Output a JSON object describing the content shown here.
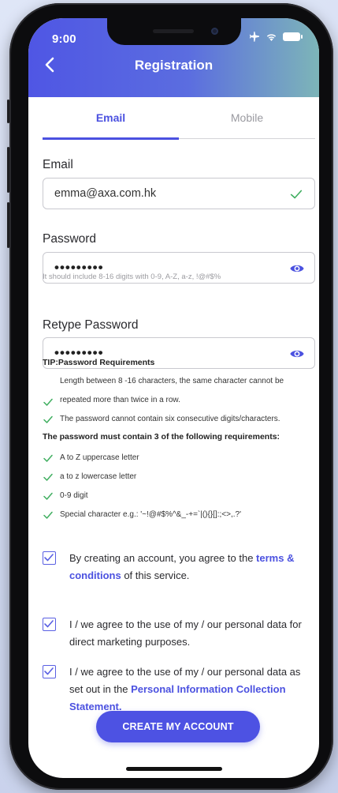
{
  "status_bar": {
    "time": "9:00"
  },
  "header": {
    "title": "Registration"
  },
  "tabs": [
    {
      "label": "Email",
      "active": true
    },
    {
      "label": "Mobile",
      "active": false
    }
  ],
  "email": {
    "label": "Email",
    "value": "emma@axa.com.hk"
  },
  "password": {
    "label": "Password",
    "value": "•••••••••",
    "hint": "It should include 8-16 digits with 0-9, A-Z, a-z, !@#$%"
  },
  "retype_password": {
    "label": "Retype Password",
    "value": "•••••••••"
  },
  "requirements": {
    "title": "TIP:Password Requirements",
    "rule_1_line_1": "Length between 8 -16 characters, the same character cannot be",
    "rule_1_line_2": "repeated more than twice in a row.",
    "rule_2": "The password cannot contain six consecutive digits/characters.",
    "must_contain": "The password must contain 3 of the following requirements:",
    "items": [
      "A to Z uppercase letter",
      "a to z lowercase letter",
      "0-9 digit",
      "Special character e.g.: '~!@#$%^&_-+=`|(){}[]:;<>,.?'"
    ]
  },
  "agreements": {
    "terms_prefix": "By creating an account, you agree to the ",
    "terms_link": "terms & conditions",
    "terms_suffix": " of this service.",
    "marketing": "I / we agree to the use of my / our personal data for direct marketing purposes.",
    "pics_prefix": "I / we agree to the use of my / our personal data as set out in the ",
    "pics_link": "Personal Information Collection Statement."
  },
  "create_button": {
    "label": "CREATE MY ACCOUNT"
  },
  "colors": {
    "accent": "#4b51e0",
    "check": "#3fae5f"
  }
}
